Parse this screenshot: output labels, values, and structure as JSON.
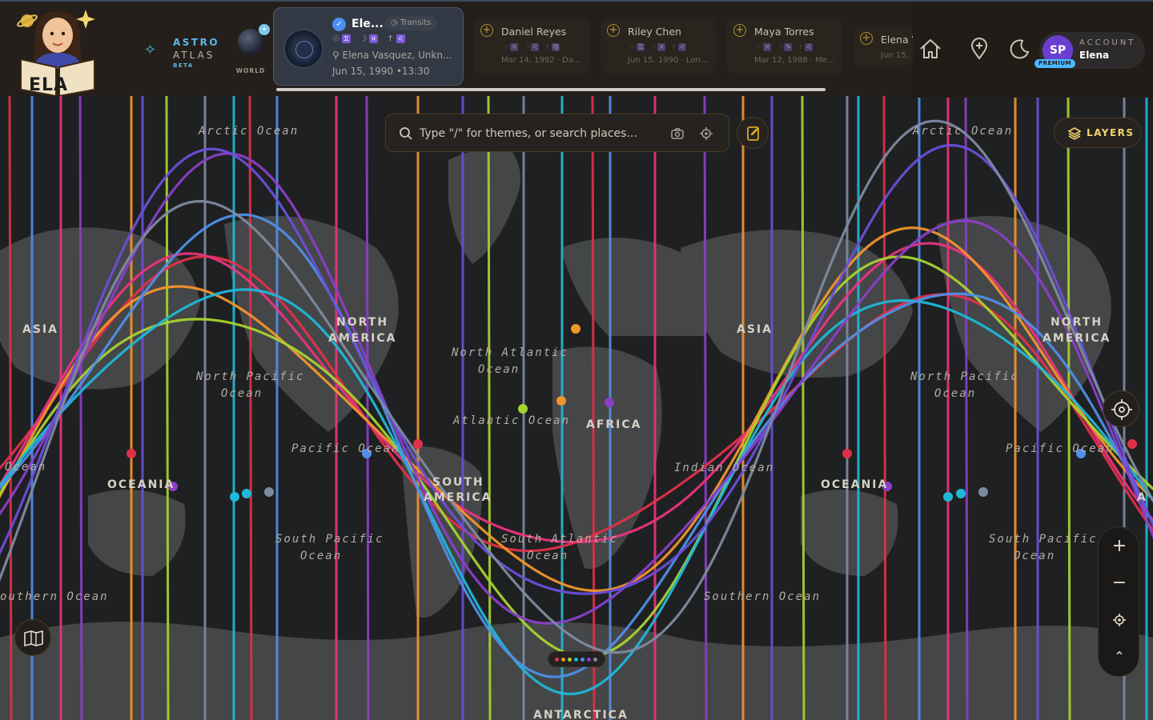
{
  "app": {
    "logo_text": "ELA",
    "brand_line1": "ASTRO",
    "brand_line2": "ATLAS",
    "brand_badge": "BETA"
  },
  "world": {
    "label": "WORLD"
  },
  "active_chart": {
    "name": "Ele...",
    "transits_label": "Transits",
    "place": "Elena Vasquez, Unkn...",
    "date": "Jun 15, 1990 •13:30",
    "signs": [
      "♊",
      "♓",
      "♌"
    ]
  },
  "profiles": [
    {
      "name": "Daniel Reyes",
      "date": "Mar 14, 1992 · Da..."
    },
    {
      "name": "Riley Chen",
      "date": "Jun 15, 1990 · Lon..."
    },
    {
      "name": "Maya Torres",
      "date": "Mar 12, 1988 · Me..."
    },
    {
      "name": "Elena V",
      "date": "Jun 15,"
    }
  ],
  "account": {
    "initials": "SP",
    "badge": "PREMIUM",
    "label": "ACCOUNT",
    "user": "Elena"
  },
  "search": {
    "placeholder": "Type \"/\" for themes, or search places..."
  },
  "layers_button": {
    "label": "LAYERS"
  },
  "map_labels": {
    "arctic_1": "Arctic Ocean",
    "arctic_2": "Arctic Ocean",
    "asia_1": "ASIA",
    "asia_2": "ASIA",
    "north_america_1a": "NORTH",
    "north_america_1b": "AMERICA",
    "north_america_2a": "NORTH",
    "north_america_2b": "AMERICA",
    "north_atlantic_a": "North Atlantic",
    "north_atlantic_b": "Ocean",
    "north_pacific_1a": "North Pacific",
    "north_pacific_1b": "Ocean",
    "north_pacific_2a": "North Pacific",
    "north_pacific_2b": "Ocean",
    "atlantic": "Atlantic Ocean",
    "africa": "AFRICA",
    "pacific_1": "Pacific Ocean",
    "pacific_2": "Pacific Ocean",
    "indian": "Indian Ocean",
    "ocean_left": "Ocean",
    "oceania_1": "OCEANIA",
    "oceania_2": "OCEANIA",
    "south_america_a": "SOUTH",
    "south_america_b": "AMERICA",
    "south_pacific_1a": "South Pacific",
    "south_pacific_1b": "Ocean",
    "south_pacific_2a": "South Pacific",
    "south_pacific_2b": "Ocean",
    "south_atlantic_a": "South Atlantic",
    "south_atlantic_b": "Ocean",
    "southern_1": "outhern Ocean",
    "southern_2": "Southern Ocean",
    "antarctica": "ANTARCTICA",
    "asia_edge": "A"
  },
  "colors": {
    "accent_gold": "#d8a928",
    "line_red": "#e0304a",
    "line_pink": "#e8347e",
    "line_orange": "#f0962c",
    "line_lime": "#a7d332",
    "line_cyan": "#1fb8d8",
    "line_blue": "#4f8fe8",
    "line_purple": "#8b3fc8",
    "line_violet": "#6a4fd8",
    "line_gray": "#7d8aa0"
  }
}
